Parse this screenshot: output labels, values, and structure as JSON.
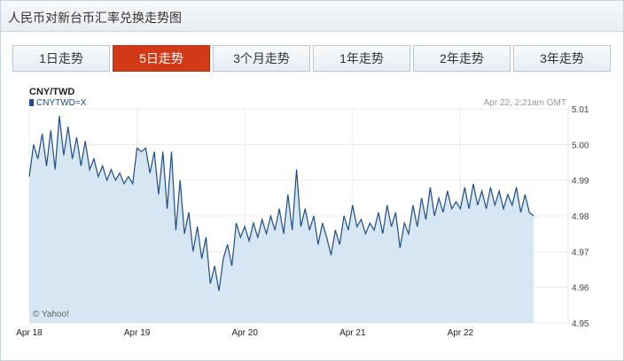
{
  "header": {
    "title": "人民币对新台币汇率兑换走势图"
  },
  "tabs": [
    {
      "label": "1日走势",
      "active": false
    },
    {
      "label": "5日走势",
      "active": true
    },
    {
      "label": "3个月走势",
      "active": false
    },
    {
      "label": "1年走势",
      "active": false
    },
    {
      "label": "2年走势",
      "active": false
    },
    {
      "label": "3年走势",
      "active": false
    }
  ],
  "colors": {
    "accent": "#d23a17",
    "line": "#1f4e8a",
    "fill": "#d6e6f2"
  },
  "chart_data": {
    "type": "area",
    "title": "CNY/TWD",
    "timestamp": "Apr 22, 2:21am GMT",
    "credit": "© Yahoo!",
    "grid": true,
    "legend_position": "top-left",
    "x_ticks": [
      "Apr 18",
      "Apr 19",
      "Apr 20",
      "Apr 21",
      "Apr 22"
    ],
    "y_ticks": [
      "5.01",
      "5.00",
      "4.99",
      "4.98",
      "4.97",
      "4.96",
      "4.95"
    ],
    "ylim": [
      4.95,
      5.01
    ],
    "xlim": [
      0,
      5
    ],
    "series": [
      {
        "name": "CNYTWD=X",
        "points": [
          [
            0.0,
            4.991
          ],
          [
            0.04,
            5.0
          ],
          [
            0.08,
            4.996
          ],
          [
            0.12,
            5.003
          ],
          [
            0.16,
            4.994
          ],
          [
            0.2,
            5.004
          ],
          [
            0.24,
            4.993
          ],
          [
            0.28,
            5.008
          ],
          [
            0.32,
            4.997
          ],
          [
            0.36,
            5.005
          ],
          [
            0.4,
            4.996
          ],
          [
            0.44,
            5.002
          ],
          [
            0.48,
            4.994
          ],
          [
            0.52,
            5.001
          ],
          [
            0.56,
            4.993
          ],
          [
            0.6,
            4.996
          ],
          [
            0.64,
            4.991
          ],
          [
            0.68,
            4.994
          ],
          [
            0.72,
            4.99
          ],
          [
            0.76,
            4.993
          ],
          [
            0.8,
            4.99
          ],
          [
            0.84,
            4.992
          ],
          [
            0.88,
            4.989
          ],
          [
            0.92,
            4.991
          ],
          [
            0.96,
            4.989
          ],
          [
            1.0,
            4.999
          ],
          [
            1.04,
            4.998
          ],
          [
            1.08,
            4.999
          ],
          [
            1.12,
            4.992
          ],
          [
            1.16,
            4.998
          ],
          [
            1.2,
            4.986
          ],
          [
            1.24,
            4.998
          ],
          [
            1.28,
            4.982
          ],
          [
            1.32,
            4.998
          ],
          [
            1.36,
            4.976
          ],
          [
            1.4,
            4.99
          ],
          [
            1.44,
            4.975
          ],
          [
            1.48,
            4.981
          ],
          [
            1.52,
            4.97
          ],
          [
            1.56,
            4.977
          ],
          [
            1.6,
            4.968
          ],
          [
            1.64,
            4.974
          ],
          [
            1.68,
            4.961
          ],
          [
            1.72,
            4.966
          ],
          [
            1.76,
            4.959
          ],
          [
            1.8,
            4.968
          ],
          [
            1.84,
            4.972
          ],
          [
            1.88,
            4.966
          ],
          [
            1.92,
            4.978
          ],
          [
            1.96,
            4.974
          ],
          [
            2.0,
            4.977
          ],
          [
            2.04,
            4.973
          ],
          [
            2.08,
            4.978
          ],
          [
            2.12,
            4.974
          ],
          [
            2.16,
            4.979
          ],
          [
            2.2,
            4.975
          ],
          [
            2.24,
            4.98
          ],
          [
            2.28,
            4.976
          ],
          [
            2.32,
            4.982
          ],
          [
            2.36,
            4.975
          ],
          [
            2.4,
            4.986
          ],
          [
            2.44,
            4.976
          ],
          [
            2.48,
            4.993
          ],
          [
            2.52,
            4.977
          ],
          [
            2.56,
            4.982
          ],
          [
            2.6,
            4.976
          ],
          [
            2.64,
            4.98
          ],
          [
            2.68,
            4.972
          ],
          [
            2.72,
            4.978
          ],
          [
            2.76,
            4.974
          ],
          [
            2.8,
            4.969
          ],
          [
            2.84,
            4.976
          ],
          [
            2.88,
            4.972
          ],
          [
            2.92,
            4.98
          ],
          [
            2.96,
            4.976
          ],
          [
            3.0,
            4.983
          ],
          [
            3.04,
            4.977
          ],
          [
            3.08,
            4.979
          ],
          [
            3.12,
            4.975
          ],
          [
            3.16,
            4.978
          ],
          [
            3.2,
            4.976
          ],
          [
            3.24,
            4.981
          ],
          [
            3.28,
            4.975
          ],
          [
            3.32,
            4.983
          ],
          [
            3.36,
            4.977
          ],
          [
            3.4,
            4.981
          ],
          [
            3.44,
            4.971
          ],
          [
            3.48,
            4.978
          ],
          [
            3.52,
            4.975
          ],
          [
            3.56,
            4.983
          ],
          [
            3.6,
            4.977
          ],
          [
            3.64,
            4.985
          ],
          [
            3.68,
            4.979
          ],
          [
            3.72,
            4.988
          ],
          [
            3.76,
            4.98
          ],
          [
            3.8,
            4.985
          ],
          [
            3.84,
            4.981
          ],
          [
            3.88,
            4.987
          ],
          [
            3.92,
            4.982
          ],
          [
            3.96,
            4.984
          ],
          [
            4.0,
            4.982
          ],
          [
            4.04,
            4.988
          ],
          [
            4.08,
            4.982
          ],
          [
            4.12,
            4.989
          ],
          [
            4.16,
            4.983
          ],
          [
            4.2,
            4.987
          ],
          [
            4.24,
            4.982
          ],
          [
            4.28,
            4.988
          ],
          [
            4.32,
            4.983
          ],
          [
            4.36,
            4.987
          ],
          [
            4.4,
            4.982
          ],
          [
            4.44,
            4.986
          ],
          [
            4.48,
            4.983
          ],
          [
            4.52,
            4.988
          ],
          [
            4.56,
            4.981
          ],
          [
            4.6,
            4.986
          ],
          [
            4.64,
            4.981
          ],
          [
            4.68,
            4.98
          ]
        ]
      }
    ]
  }
}
